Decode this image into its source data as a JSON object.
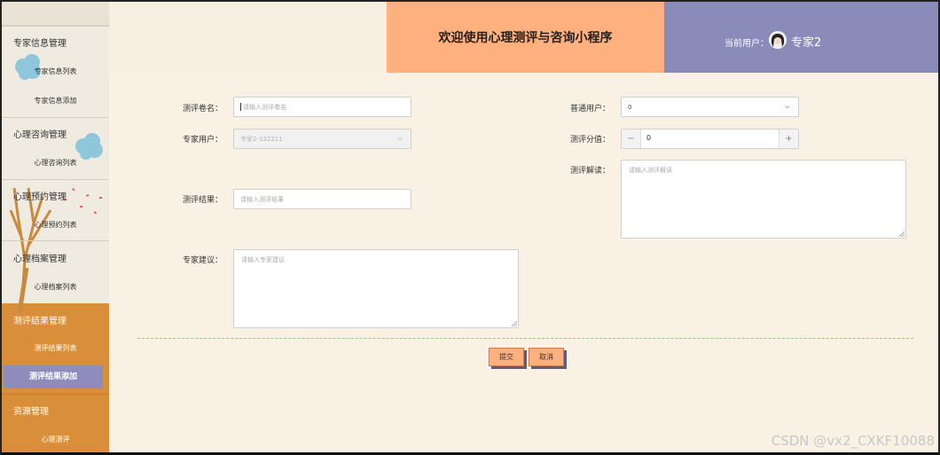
{
  "header": {
    "title": "欢迎使用心理测评与咨询小程序",
    "current_user_label": "当前用户：",
    "user_name": "专家2"
  },
  "sidebar": {
    "groups": [
      {
        "title": "专家信息管理",
        "items": [
          "专家信息列表",
          "专家信息添加"
        ]
      },
      {
        "title": "心理咨询管理",
        "items": [
          "心理咨询列表"
        ]
      },
      {
        "title": "心理预约管理",
        "items": [
          "心理预约列表"
        ]
      },
      {
        "title": "心理档案管理",
        "items": [
          "心理档案列表"
        ]
      },
      {
        "title": "测评结果管理",
        "items": [
          "测评结果列表",
          "测评结果添加"
        ]
      },
      {
        "title": "资源管理",
        "items": [
          "心理测评"
        ]
      }
    ]
  },
  "form": {
    "survey_name": {
      "label": "测评卷名：",
      "placeholder": "请输入测评卷名"
    },
    "normal_user": {
      "label": "普通用户：",
      "value": "0"
    },
    "expert_user": {
      "label": "专家用户：",
      "value": "专家2-332211"
    },
    "score": {
      "label": "测评分值：",
      "value": "0",
      "minus": "−",
      "plus": "+"
    },
    "interpretation": {
      "label": "测评解读：",
      "placeholder": "请输入测评解读"
    },
    "result": {
      "label": "测评结果：",
      "placeholder": "请输入测评结果"
    },
    "advice": {
      "label": "专家建议：",
      "placeholder": "请输入专家建议"
    },
    "submit": "提交",
    "cancel": "取消"
  },
  "watermark": "CSDN @vx2_CXKF10088",
  "colors": {
    "accent_orange": "#ffb07f",
    "accent_purple": "#8b8bba",
    "sidebar_orange": "#d98f3a",
    "background": "#f8f1e4"
  }
}
